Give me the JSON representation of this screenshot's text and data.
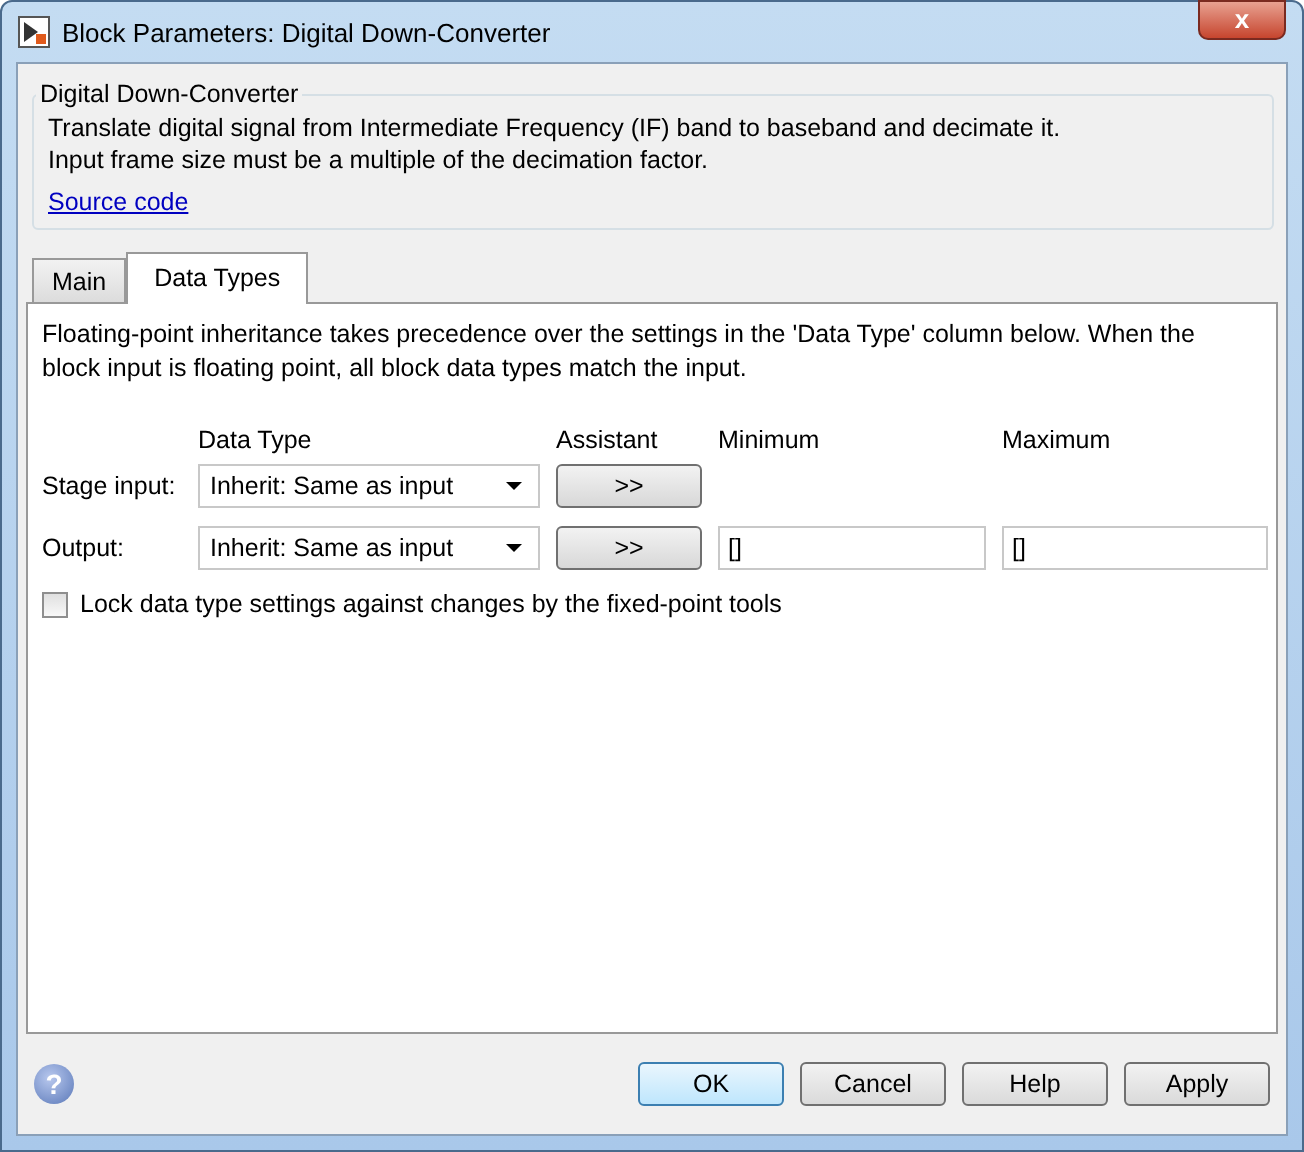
{
  "window": {
    "title": "Block Parameters: Digital Down-Converter",
    "close_glyph": "x"
  },
  "description": {
    "group_title": "Digital Down-Converter",
    "lines": [
      "Translate digital signal from Intermediate Frequency (IF) band to baseband and decimate it.",
      "Input frame size must be a multiple of the decimation factor."
    ],
    "link": "Source code"
  },
  "tabs": [
    {
      "label": "Main",
      "selected": false
    },
    {
      "label": "Data Types",
      "selected": true
    }
  ],
  "panel": {
    "note": "Floating-point inheritance takes precedence over the settings in the 'Data Type' column below. When the block input is floating point, all block data types match the input.",
    "columns": [
      "Data Type",
      "Assistant",
      "Minimum",
      "Maximum"
    ],
    "rows": [
      {
        "label": "Stage input:",
        "data_type": "Inherit: Same as input",
        "assistant": ">>"
      },
      {
        "label": "Output:",
        "data_type": "Inherit: Same as input",
        "assistant": ">>",
        "minimum": "[]",
        "maximum": "[]"
      }
    ],
    "lock": {
      "label": "Lock data type settings against changes by the fixed-point tools",
      "checked": false
    }
  },
  "help_glyph": "?",
  "buttons": [
    {
      "label": "OK",
      "default": true
    },
    {
      "label": "Cancel",
      "default": false
    },
    {
      "label": "Help",
      "default": false
    },
    {
      "label": "Apply",
      "default": false
    }
  ]
}
